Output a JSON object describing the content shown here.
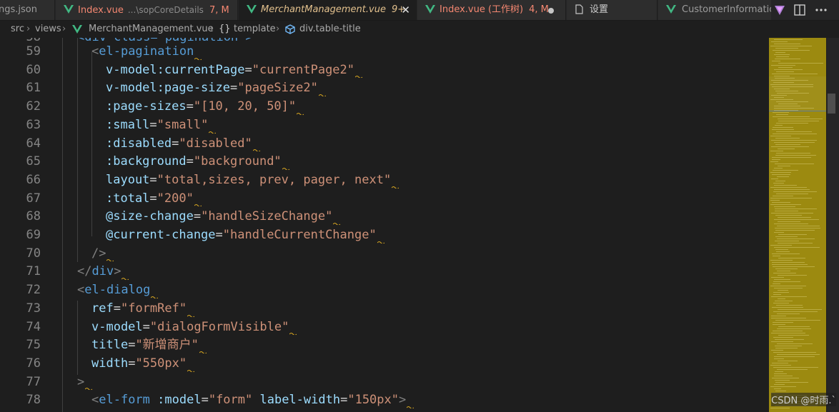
{
  "tabs": [
    {
      "label": "ngs.json",
      "desc": "",
      "status": ""
    },
    {
      "label": "Index.vue",
      "desc": "...\\sopCoreDetails",
      "status": "7, M"
    },
    {
      "label": "MerchantManagement.vue",
      "desc": "",
      "status": "9+"
    },
    {
      "label": "Index.vue (工作树)",
      "desc": "",
      "status": "4, M"
    },
    {
      "label": "设置",
      "desc": "",
      "status": ""
    },
    {
      "label": "CustomerInformatic",
      "desc": "",
      "status": ""
    }
  ],
  "breadcrumb": {
    "items": [
      "src",
      "views",
      "MerchantManagement.vue",
      "template",
      "div.table-title"
    ]
  },
  "editor": {
    "top_partial": "<div class=\"pagination\">",
    "lines": [
      {
        "n": "59",
        "parts": [
          [
            "br",
            "<"
          ],
          [
            "tag",
            "el-pagination"
          ]
        ]
      },
      {
        "n": "60",
        "parts": [
          [
            "attr",
            "v-model:currentPage"
          ],
          [
            "eq",
            "="
          ],
          [
            "str",
            "\"currentPage2\""
          ]
        ]
      },
      {
        "n": "61",
        "parts": [
          [
            "attr",
            "v-model:page-size"
          ],
          [
            "eq",
            "="
          ],
          [
            "str",
            "\"pageSize2\""
          ]
        ]
      },
      {
        "n": "62",
        "parts": [
          [
            "attr",
            ":page-sizes"
          ],
          [
            "eq",
            "="
          ],
          [
            "str",
            "\"[10, 20, 50]\""
          ]
        ]
      },
      {
        "n": "63",
        "parts": [
          [
            "attr",
            ":small"
          ],
          [
            "eq",
            "="
          ],
          [
            "str",
            "\"small\""
          ]
        ]
      },
      {
        "n": "64",
        "parts": [
          [
            "attr",
            ":disabled"
          ],
          [
            "eq",
            "="
          ],
          [
            "str",
            "\"disabled\""
          ]
        ]
      },
      {
        "n": "65",
        "parts": [
          [
            "attr",
            ":background"
          ],
          [
            "eq",
            "="
          ],
          [
            "str",
            "\"background\""
          ]
        ]
      },
      {
        "n": "66",
        "parts": [
          [
            "attr",
            "layout"
          ],
          [
            "eq",
            "="
          ],
          [
            "str",
            "\"total,sizes, prev, pager, next\""
          ]
        ]
      },
      {
        "n": "67",
        "parts": [
          [
            "attr",
            ":total"
          ],
          [
            "eq",
            "="
          ],
          [
            "str",
            "\"200\""
          ]
        ]
      },
      {
        "n": "68",
        "parts": [
          [
            "attr",
            "@size-change"
          ],
          [
            "eq",
            "="
          ],
          [
            "str",
            "\"handleSizeChange\""
          ]
        ]
      },
      {
        "n": "69",
        "parts": [
          [
            "attr",
            "@current-change"
          ],
          [
            "eq",
            "="
          ],
          [
            "str",
            "\"handleCurrentChange\""
          ]
        ]
      },
      {
        "n": "70",
        "parts": [
          [
            "br",
            "/>"
          ]
        ]
      },
      {
        "n": "71",
        "parts": [
          [
            "br",
            "</"
          ],
          [
            "tag",
            "div"
          ],
          [
            "br",
            ">"
          ]
        ]
      },
      {
        "n": "72",
        "parts": [
          [
            "br",
            "<"
          ],
          [
            "tag",
            "el-dialog"
          ]
        ]
      },
      {
        "n": "73",
        "parts": [
          [
            "attr",
            "ref"
          ],
          [
            "eq",
            "="
          ],
          [
            "str",
            "\"formRef\""
          ]
        ]
      },
      {
        "n": "74",
        "parts": [
          [
            "attr",
            "v-model"
          ],
          [
            "eq",
            "="
          ],
          [
            "str",
            "\"dialogFormVisible\""
          ]
        ]
      },
      {
        "n": "75",
        "parts": [
          [
            "attr",
            "title"
          ],
          [
            "eq",
            "="
          ],
          [
            "str",
            "\"新增商户\""
          ]
        ]
      },
      {
        "n": "76",
        "parts": [
          [
            "attr",
            "width"
          ],
          [
            "eq",
            "="
          ],
          [
            "str",
            "\"550px\""
          ]
        ]
      },
      {
        "n": "77",
        "parts": [
          [
            "br",
            ">"
          ]
        ]
      },
      {
        "n": "78",
        "parts": [
          [
            "br",
            "<"
          ],
          [
            "tag",
            "el-form"
          ],
          [
            "eq",
            " "
          ],
          [
            "attr",
            ":model"
          ],
          [
            "eq",
            "="
          ],
          [
            "str",
            "\"form\""
          ],
          [
            "eq",
            " "
          ],
          [
            "attr",
            "label-width"
          ],
          [
            "eq",
            "="
          ],
          [
            "str",
            "\"150px\""
          ],
          [
            "br",
            ">"
          ]
        ]
      }
    ]
  },
  "watermark": "CSDN @时雨.`",
  "colors": {
    "tag": "#569cd6",
    "attribute": "#9cdcfe",
    "string": "#ce9178",
    "bracket": "#808080",
    "line_number": "#858585",
    "background": "#1e1e1e",
    "minimap": "#9c8a10"
  },
  "icons": {
    "vue": "vue-file-icon",
    "settings_page": "file-page-icon",
    "copilot": "copilot-icon",
    "split": "split-editor-icon",
    "more": "more-actions-icon"
  }
}
